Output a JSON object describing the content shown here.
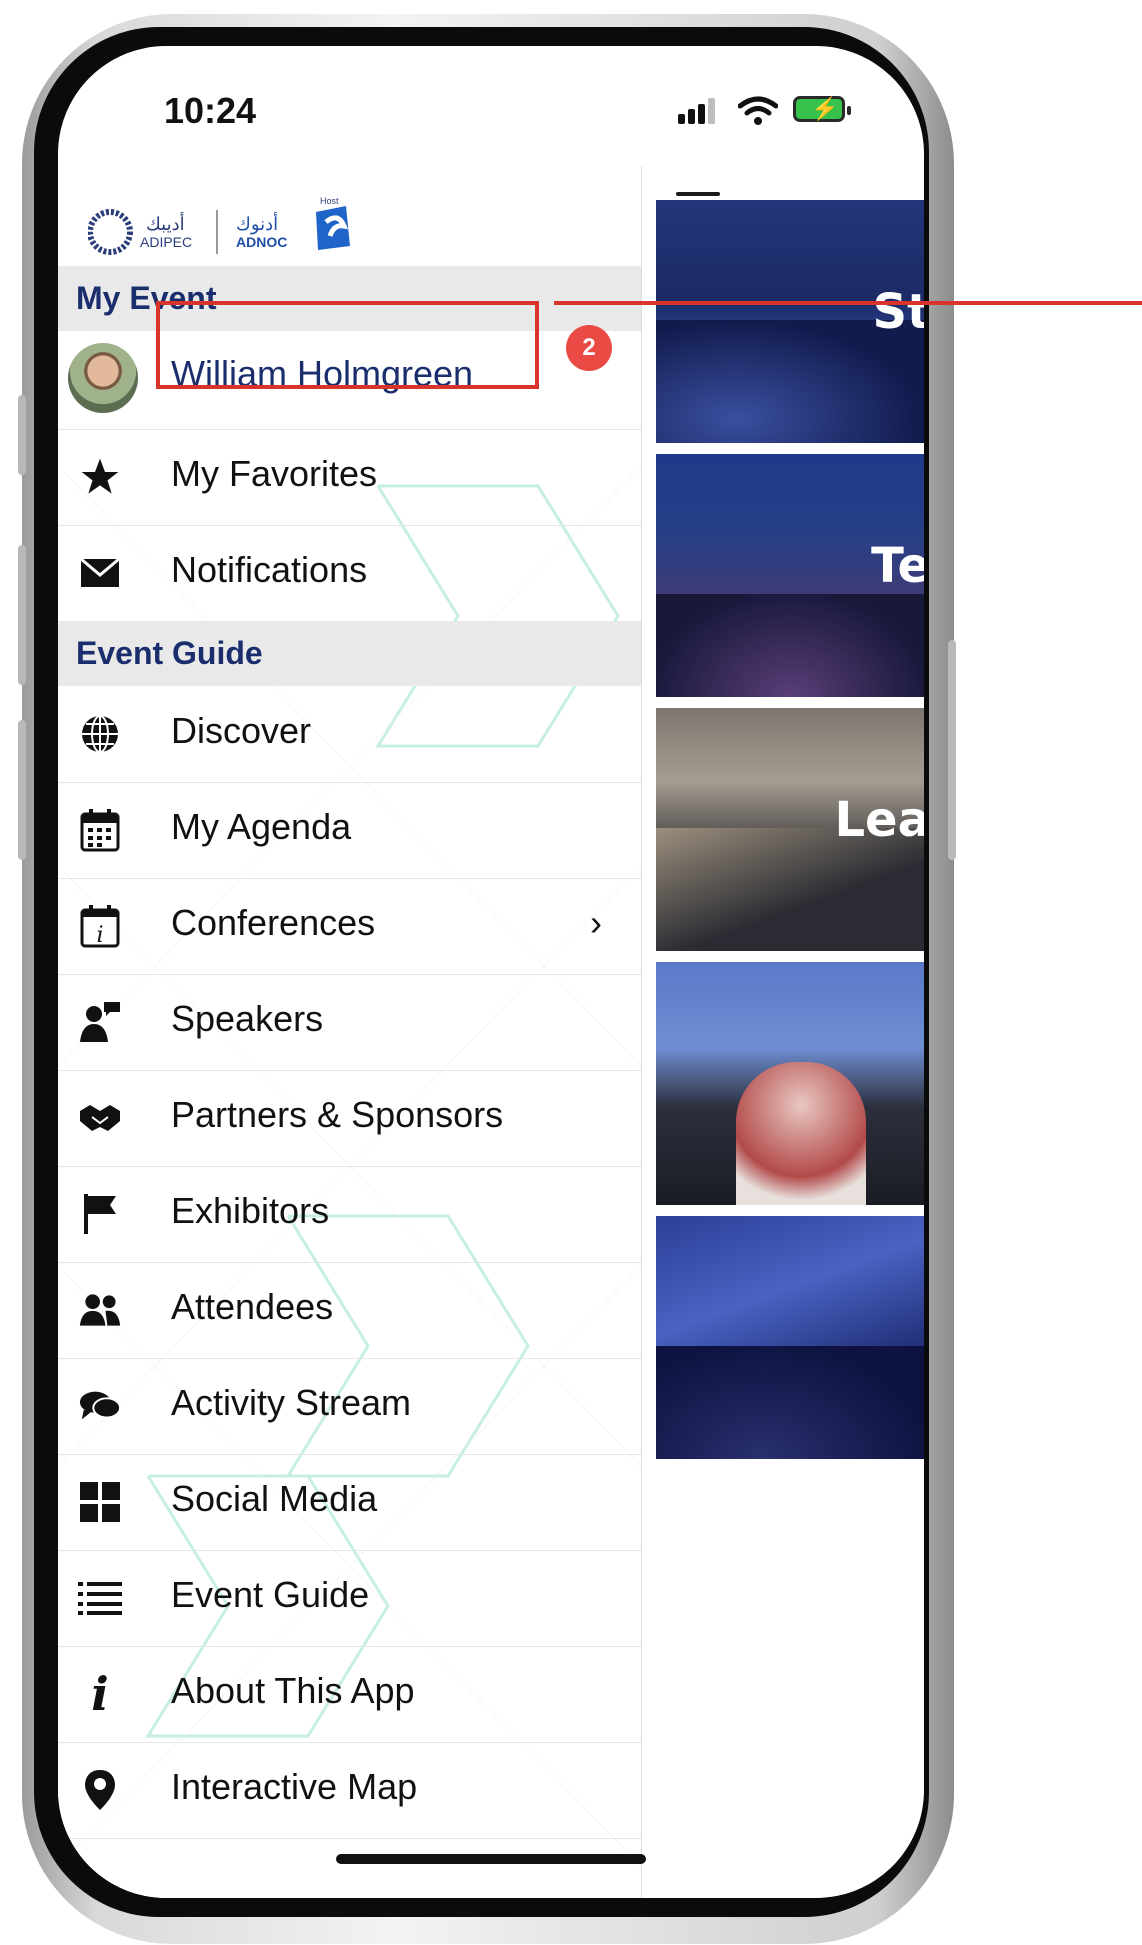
{
  "status": {
    "time": "10:24"
  },
  "header": {
    "logo_left": "ADIPEC",
    "logo_left_ar": "أديبك",
    "logo_right": "ADNOC",
    "logo_right_ar": "أدنوك",
    "logo_host": "Host"
  },
  "sections": {
    "my_event": "My Event",
    "event_guide": "Event Guide"
  },
  "profile": {
    "name": "William Holmgreen"
  },
  "annotation": {
    "step": "2",
    "color": "#d9342b"
  },
  "my_event_items": [
    {
      "label": "My Favorites",
      "icon": "star-icon"
    },
    {
      "label": "Notifications",
      "icon": "envelope-icon"
    }
  ],
  "guide_items": [
    {
      "label": "Discover",
      "icon": "globe-icon"
    },
    {
      "label": "My Agenda",
      "icon": "calendar-icon"
    },
    {
      "label": "Conferences",
      "icon": "calendar-info-icon"
    },
    {
      "label": "Speakers",
      "icon": "speaker-icon"
    },
    {
      "label": "Partners & Sponsors",
      "icon": "handshake-icon"
    },
    {
      "label": "Exhibitors",
      "icon": "flag-icon"
    },
    {
      "label": "Attendees",
      "icon": "users-icon"
    },
    {
      "label": "Activity Stream",
      "icon": "chat-icon"
    },
    {
      "label": "Social Media",
      "icon": "grid-icon"
    },
    {
      "label": "Event Guide",
      "icon": "list-icon"
    },
    {
      "label": "About This App",
      "icon": "info-icon"
    },
    {
      "label": "Interactive Map",
      "icon": "map-pin-icon"
    }
  ],
  "feed": [
    {
      "title": "St"
    },
    {
      "title": "Te"
    },
    {
      "title": "Lea"
    },
    {
      "title": ""
    },
    {
      "title": ""
    }
  ],
  "colors": {
    "section_text": "#1a2e6e",
    "pattern": "#5fd3b3",
    "badge": "#e94a44"
  }
}
